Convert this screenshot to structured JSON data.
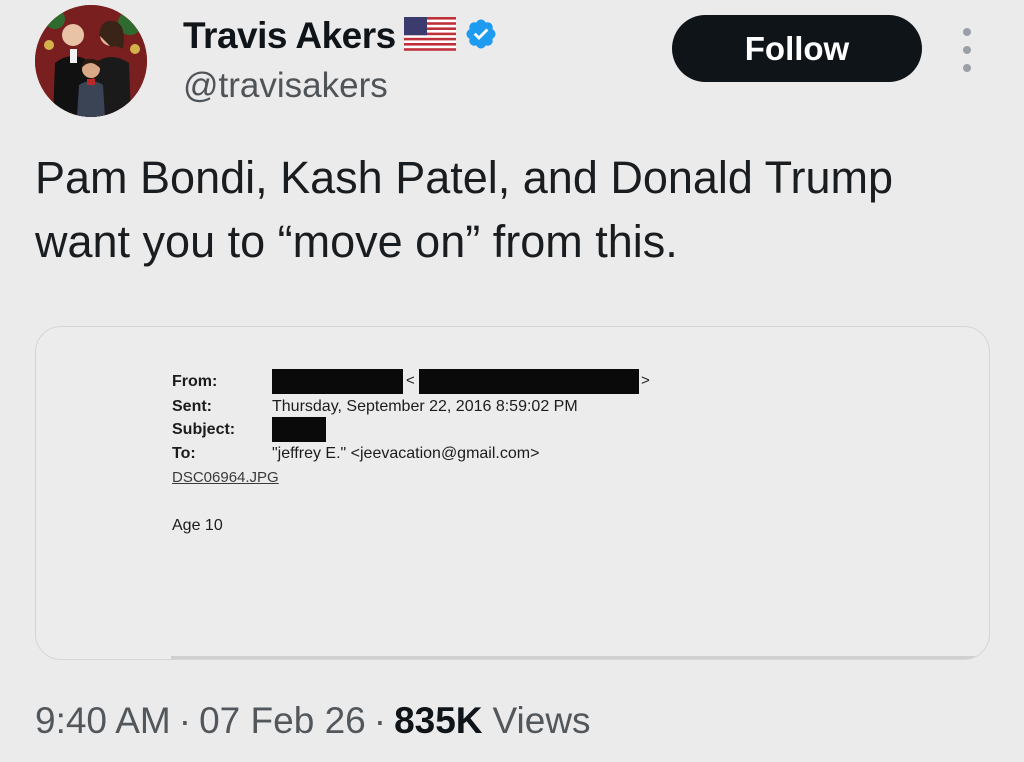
{
  "author": {
    "name": "Travis Akers",
    "handle": "@travisakers",
    "verified_color": "#1d9bf0",
    "flag_icon": "us-flag-icon"
  },
  "follow_label": "Follow",
  "tweet_text": "Pam Bondi, Kash Patel, and Donald Trump want you to “move on” from this.",
  "email": {
    "from_label": "From:",
    "sent_label": "Sent:",
    "sent_value": "Thursday, September 22, 2016 8:59:02 PM",
    "subject_label": "Subject:",
    "to_label": "To:",
    "to_value": "\"jeffrey E.\" <jeevacation@gmail.com>",
    "attachment": "DSC06964.JPG",
    "body": "Age 10"
  },
  "meta": {
    "time": "9:40 AM",
    "date": "07 Feb 26",
    "views_count": "835K",
    "views_label": "Views"
  }
}
